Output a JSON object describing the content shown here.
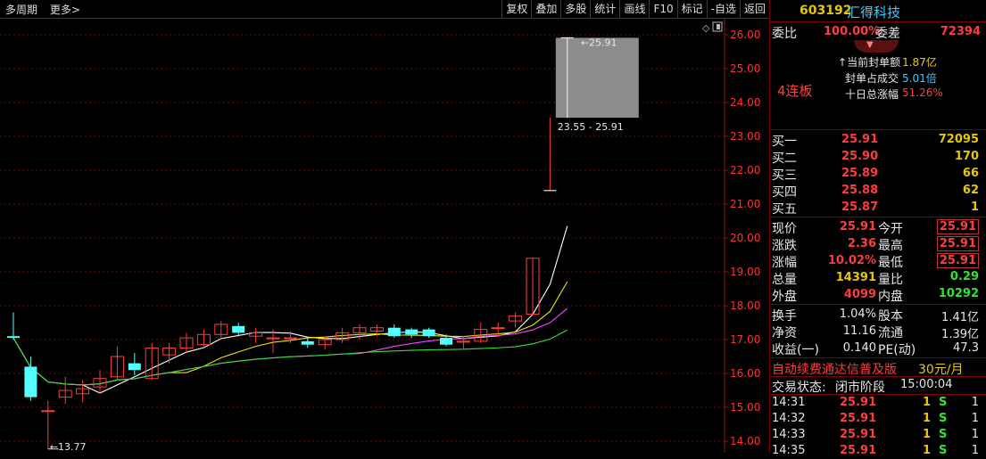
{
  "toolbar": {
    "left": [
      "多周期",
      "更多>"
    ],
    "buttons": [
      "复权",
      "叠加",
      "多股",
      "统计",
      "画线",
      "F10",
      "标记",
      "-自选",
      "返回"
    ]
  },
  "chart_data": {
    "type": "candlestick",
    "ylim": [
      13.77,
      26.2
    ],
    "y_ticks": [
      "26.00",
      "25.00",
      "24.00",
      "23.00",
      "22.00",
      "21.00",
      "20.00",
      "19.00",
      "18.00",
      "17.00",
      "16.00",
      "15.00",
      "14.00"
    ],
    "annotations": {
      "max_label": "25.91",
      "min_label": "13.77",
      "range_label": "23.55 - 25.91"
    },
    "candles": [
      {
        "o": 17.1,
        "c": 17.05,
        "h": 17.8,
        "l": 17.0
      },
      {
        "o": 16.2,
        "c": 15.3,
        "h": 16.5,
        "l": 15.2
      },
      {
        "o": 14.9,
        "c": 14.9,
        "h": 15.2,
        "l": 13.77
      },
      {
        "o": 15.3,
        "c": 15.5,
        "h": 15.9,
        "l": 15.1
      },
      {
        "o": 15.4,
        "c": 15.55,
        "h": 15.8,
        "l": 15.15
      },
      {
        "o": 15.6,
        "c": 15.85,
        "h": 16.1,
        "l": 15.4
      },
      {
        "o": 15.9,
        "c": 16.5,
        "h": 16.8,
        "l": 15.8
      },
      {
        "o": 16.3,
        "c": 16.1,
        "h": 16.6,
        "l": 15.95
      },
      {
        "o": 15.85,
        "c": 16.75,
        "h": 16.9,
        "l": 15.8
      },
      {
        "o": 16.55,
        "c": 16.75,
        "h": 16.9,
        "l": 16.3
      },
      {
        "o": 16.75,
        "c": 17.05,
        "h": 17.2,
        "l": 16.6
      },
      {
        "o": 16.85,
        "c": 17.15,
        "h": 17.3,
        "l": 16.8
      },
      {
        "o": 17.15,
        "c": 17.45,
        "h": 17.55,
        "l": 17.0
      },
      {
        "o": 17.4,
        "c": 17.2,
        "h": 17.5,
        "l": 17.1
      },
      {
        "o": 17.1,
        "c": 17.2,
        "h": 17.35,
        "l": 16.9
      },
      {
        "o": 17.05,
        "c": 17.05,
        "h": 17.3,
        "l": 16.6
      },
      {
        "o": 17.05,
        "c": 17.05,
        "h": 17.25,
        "l": 16.9
      },
      {
        "o": 16.95,
        "c": 16.85,
        "h": 17.05,
        "l": 16.75
      },
      {
        "o": 16.85,
        "c": 17.0,
        "h": 17.1,
        "l": 16.7
      },
      {
        "o": 17.0,
        "c": 17.2,
        "h": 17.35,
        "l": 16.9
      },
      {
        "o": 17.2,
        "c": 17.35,
        "h": 17.45,
        "l": 17.0
      },
      {
        "o": 17.25,
        "c": 17.35,
        "h": 17.45,
        "l": 17.1
      },
      {
        "o": 17.35,
        "c": 17.1,
        "h": 17.45,
        "l": 17.05
      },
      {
        "o": 17.3,
        "c": 17.15,
        "h": 17.35,
        "l": 17.05
      },
      {
        "o": 17.3,
        "c": 17.1,
        "h": 17.35,
        "l": 17.05
      },
      {
        "o": 17.05,
        "c": 16.85,
        "h": 17.15,
        "l": 16.8
      },
      {
        "o": 16.95,
        "c": 16.95,
        "h": 17.1,
        "l": 16.7
      },
      {
        "o": 16.95,
        "c": 17.3,
        "h": 17.5,
        "l": 16.9
      },
      {
        "o": 17.35,
        "c": 17.35,
        "h": 17.5,
        "l": 17.1
      },
      {
        "o": 17.55,
        "c": 17.7,
        "h": 17.8,
        "l": 17.35
      },
      {
        "o": 17.75,
        "c": 19.4,
        "h": 19.4,
        "l": 17.7
      },
      {
        "o": 21.4,
        "c": 21.4,
        "h": 23.55,
        "l": 21.4
      },
      {
        "o": 23.55,
        "c": 25.91,
        "h": 25.91,
        "l": 23.55
      }
    ]
  },
  "panel": {
    "code": "603192",
    "name": "汇得科技",
    "weibi_label": "委比",
    "weibi_value": "100.00%",
    "weicha_label": "委差",
    "weicha_value": "72394",
    "seal_amount_label": "当前封单额",
    "seal_amount_value": "1.87亿",
    "seal_ratio_label": "封单占成交",
    "seal_ratio_value": "5.01倍",
    "ten_day_label": "十日总涨幅",
    "ten_day_value": "51.26%",
    "streak": "4连板",
    "bids": [
      {
        "label": "买一",
        "price": "25.91",
        "vol": "72095"
      },
      {
        "label": "买二",
        "price": "25.90",
        "vol": "170"
      },
      {
        "label": "买三",
        "price": "25.89",
        "vol": "66"
      },
      {
        "label": "买四",
        "price": "25.88",
        "vol": "62"
      },
      {
        "label": "买五",
        "price": "25.87",
        "vol": "1"
      }
    ],
    "quote": [
      {
        "l1": "现价",
        "v1": "25.91",
        "l2": "今开",
        "v2": "25.91"
      },
      {
        "l1": "涨跌",
        "v1": "2.36",
        "l2": "最高",
        "v2": "25.91"
      },
      {
        "l1": "涨幅",
        "v1": "10.02%",
        "l2": "最低",
        "v2": "25.91"
      },
      {
        "l1": "总量",
        "v1": "14391",
        "l2": "量比",
        "v2": "0.29"
      },
      {
        "l1": "外盘",
        "v1": "4099",
        "l2": "内盘",
        "v2": "10292"
      }
    ],
    "finance": [
      {
        "l1": "换手",
        "v1": "1.04%",
        "l2": "股本",
        "v2": "1.41亿"
      },
      {
        "l1": "净资",
        "v1": "11.16",
        "l2": "流通",
        "v2": "1.39亿"
      },
      {
        "l1": "收益(一)",
        "v1": "0.140",
        "l2": "PE(动)",
        "v2": "47.3"
      }
    ],
    "ad_text": "自动续费通达信普及版",
    "ad_price": "30元/月",
    "status_label": "交易状态:",
    "status_value": "闭市阶段",
    "status_time": "15:00:04",
    "ticks": [
      {
        "time": "14:31",
        "price": "25.91",
        "vol": "1",
        "side": "S",
        "n": "1"
      },
      {
        "time": "14:32",
        "price": "25.91",
        "vol": "1",
        "side": "S",
        "n": "1"
      },
      {
        "time": "14:33",
        "price": "25.91",
        "vol": "1",
        "side": "S",
        "n": "1"
      },
      {
        "time": "14:35",
        "price": "25.91",
        "vol": "1",
        "side": "S",
        "n": "1"
      }
    ]
  }
}
